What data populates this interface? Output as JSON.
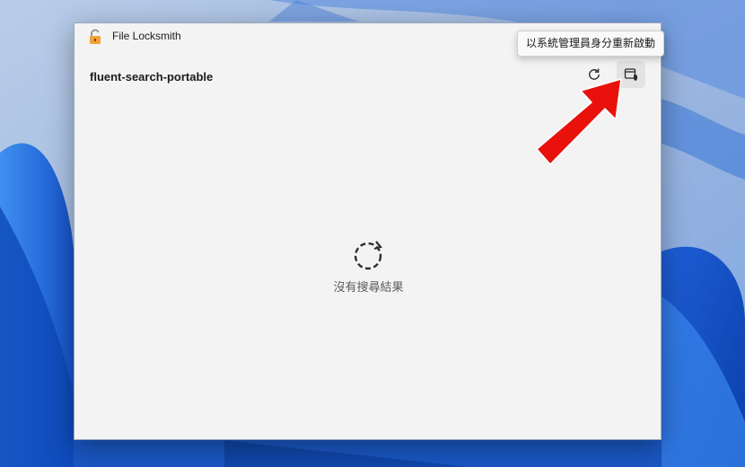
{
  "window": {
    "title": "File Locksmith",
    "app_icon": "padlock-icon",
    "caption_buttons": [
      "minimize-icon",
      "maximize-icon",
      "close-icon"
    ]
  },
  "toolbar": {
    "folder_name": "fluent-search-portable",
    "refresh_icon": "refresh-icon",
    "admin_icon": "restart-as-admin-icon"
  },
  "tooltip": {
    "text": "以系統管理員身分重新啟動"
  },
  "main": {
    "empty_icon": "search-refresh-icon",
    "empty_message": "沒有搜尋結果"
  },
  "annotation": {
    "arrow_color": "#e8110c",
    "arrow_icon": "red-arrow-pointer"
  },
  "colors": {
    "window_bg": "#f3f3f3",
    "desktop_blue": "#2f6bd6"
  }
}
